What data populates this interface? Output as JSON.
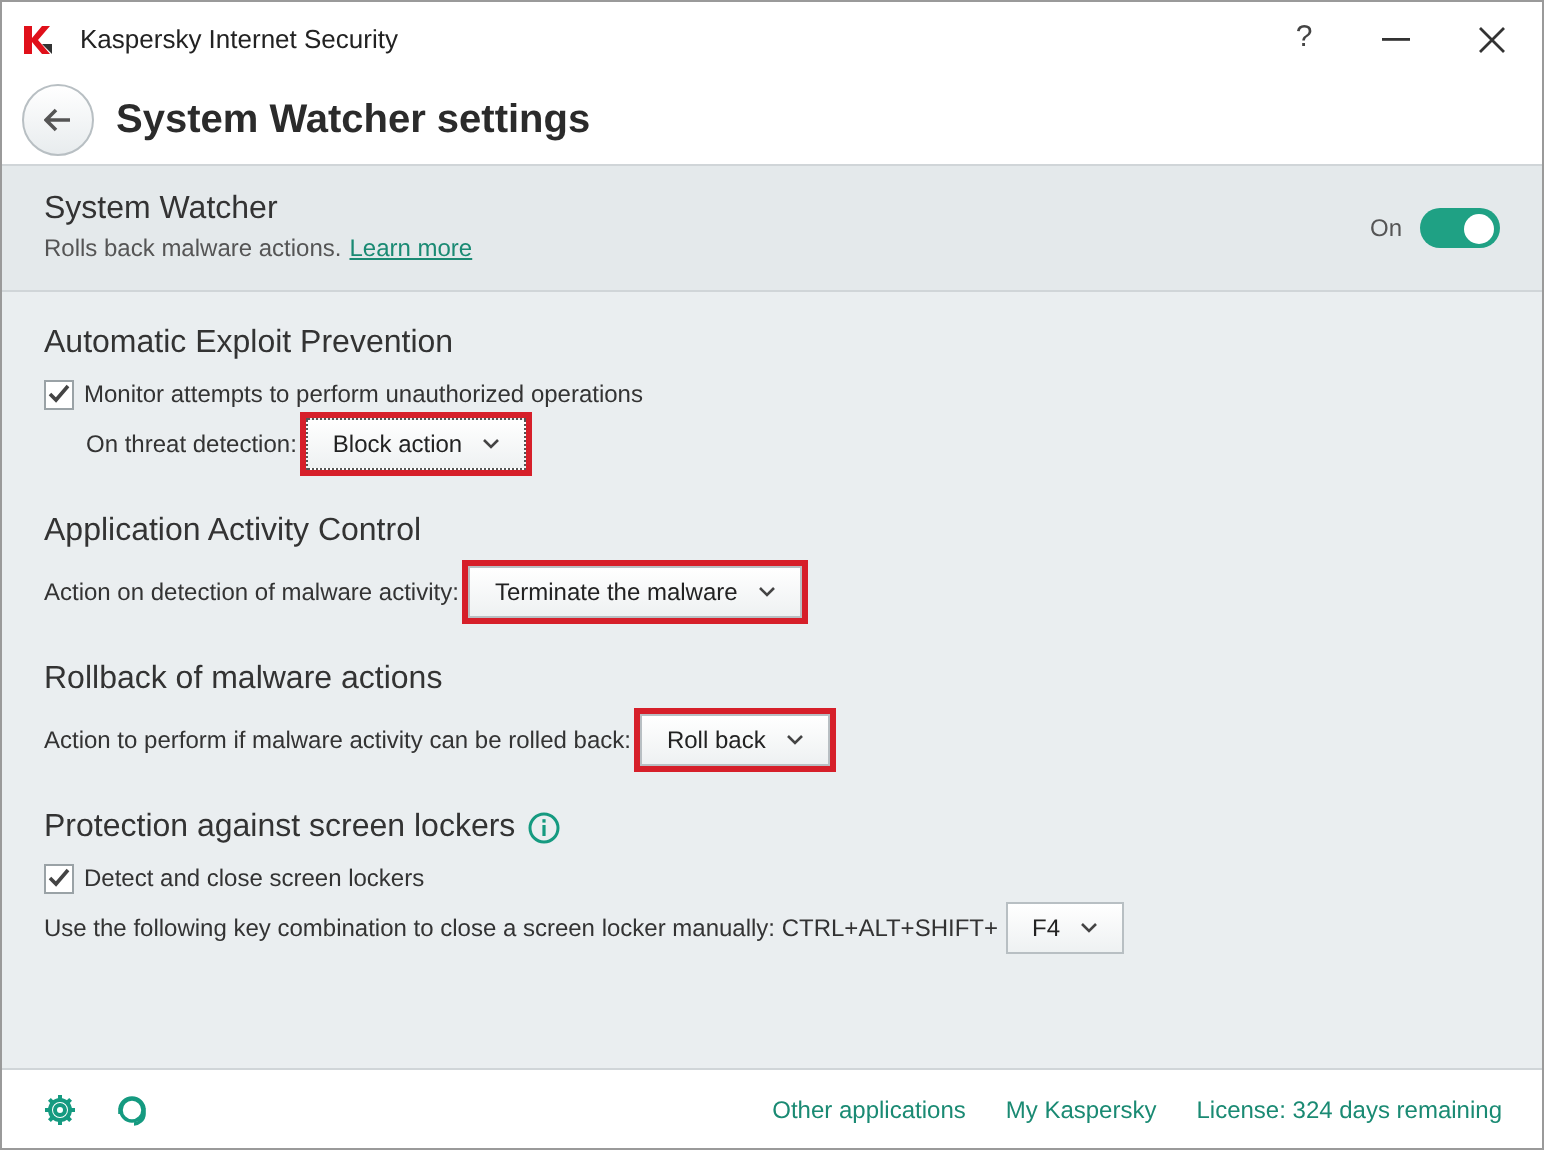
{
  "window": {
    "title": "Kaspersky Internet Security",
    "help": "?"
  },
  "header": {
    "title": "System Watcher settings"
  },
  "master": {
    "title": "System Watcher",
    "description": "Rolls back malware actions.",
    "link": "Learn more",
    "toggle_label": "On",
    "on": true
  },
  "sections": [
    {
      "title": "Automatic Exploit Prevention",
      "info": false,
      "rows": [
        {
          "kind": "checkbox",
          "label": "Monitor attempts to perform unauthorized operations",
          "checked": true,
          "children": [
            {
              "kind": "select",
              "label": "On threat detection:",
              "value": "Block action",
              "highlighted": true,
              "focused": true
            }
          ]
        }
      ]
    },
    {
      "title": "Application Activity Control",
      "info": false,
      "rows": [
        {
          "kind": "select",
          "label": "Action on detection of malware activity:",
          "value": "Terminate the malware",
          "highlighted": true,
          "focused": false
        }
      ]
    },
    {
      "title": "Rollback of malware actions",
      "info": false,
      "rows": [
        {
          "kind": "select",
          "label": "Action to perform if malware activity can be rolled back:",
          "value": "Roll back",
          "highlighted": true,
          "focused": false
        }
      ]
    },
    {
      "title": "Protection against screen lockers",
      "info": true,
      "rows": [
        {
          "kind": "checkbox",
          "label": "Detect and close screen lockers",
          "checked": true
        },
        {
          "kind": "select",
          "label": "Use the following key combination to close a screen locker manually: CTRL+ALT+SHIFT+",
          "value": "F4",
          "highlighted": false,
          "focused": false
        }
      ]
    }
  ],
  "footer": {
    "links": [
      "Other applications",
      "My Kaspersky",
      "License: 324 days remaining"
    ]
  }
}
